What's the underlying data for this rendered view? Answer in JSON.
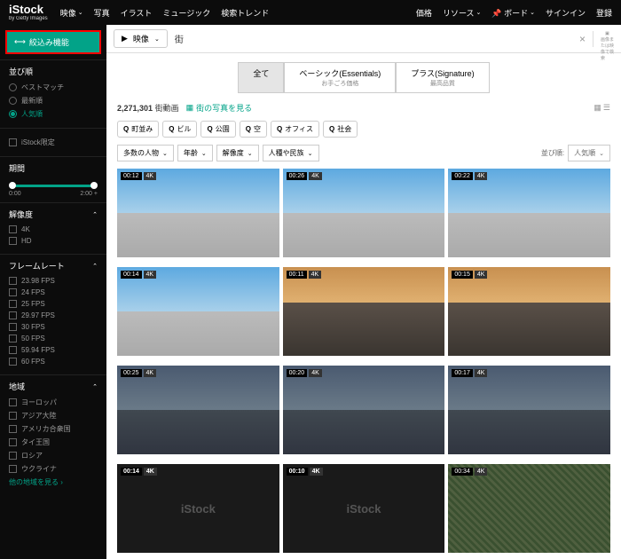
{
  "logo": {
    "main": "iStock",
    "sub": "by Getty Images"
  },
  "topnav": {
    "items": [
      "映像",
      "写真",
      "イラスト",
      "ミュージック",
      "検索トレンド"
    ],
    "right": [
      "価格",
      "リソース",
      "ボード",
      "サインイン",
      "登録"
    ]
  },
  "filter_button": "絞込み機能",
  "sidebar": {
    "sort": {
      "title": "並び順",
      "options": [
        "ベストマッチ",
        "最新順",
        "人気順"
      ],
      "selected": 2
    },
    "exclusive": "iStock限定",
    "duration": {
      "title": "期間",
      "min": "0:00",
      "max": "2:00 +"
    },
    "resolution": {
      "title": "解像度",
      "options": [
        "4K",
        "HD"
      ]
    },
    "framerate": {
      "title": "フレームレート",
      "options": [
        "23.98 FPS",
        "24 FPS",
        "25 FPS",
        "29.97 FPS",
        "30 FPS",
        "50 FPS",
        "59.94 FPS",
        "60 FPS"
      ]
    },
    "region": {
      "title": "地域",
      "options": [
        "ヨーロッパ",
        "アジア大陸",
        "アメリカ合衆国",
        "タイ王国",
        "ロシア",
        "ウクライナ"
      ],
      "more": "他の地域を見る"
    }
  },
  "search": {
    "media_type": "映像",
    "term": "街",
    "camera_hint": "画像または映像で検索"
  },
  "tabs": [
    {
      "l": "全て",
      "s": ""
    },
    {
      "l": "ベーシック(Essentials)",
      "s": "お手ごろ価格"
    },
    {
      "l": "プラス(Signature)",
      "s": "最高品質"
    }
  ],
  "results": {
    "count": "2,271,301",
    "label": "街動画",
    "photo_link": "街の写真を見る"
  },
  "chips": [
    {
      "l": "町並み"
    },
    {
      "l": "ビル"
    },
    {
      "l": "公園"
    },
    {
      "l": "空"
    },
    {
      "l": "オフィス"
    },
    {
      "l": "社会"
    }
  ],
  "dropdowns": [
    "多数の人物",
    "年齢",
    "解像度",
    "人種や民族"
  ],
  "sort_label": "並び順:",
  "sort_value": "人気順",
  "thumbs": [
    {
      "d": "00:12",
      "k": "4K",
      "c": "sky"
    },
    {
      "d": "00:26",
      "k": "4K",
      "c": "sky"
    },
    {
      "d": "00:22",
      "k": "4K",
      "c": "sky"
    },
    {
      "d": "00:14",
      "k": "4K",
      "c": "sky"
    },
    {
      "d": "00:11",
      "k": "4K",
      "c": "sunset"
    },
    {
      "d": "00:15",
      "k": "4K",
      "c": "sunset"
    },
    {
      "d": "00:25",
      "k": "4K",
      "c": "dusk"
    },
    {
      "d": "00:20",
      "k": "4K",
      "c": "dusk"
    },
    {
      "d": "00:17",
      "k": "4K",
      "c": "dusk"
    },
    {
      "d": "00:14",
      "k": "4K",
      "c": "night",
      "wm": "iStock"
    },
    {
      "d": "00:10",
      "k": "4K",
      "c": "night",
      "wm": "iStock"
    },
    {
      "d": "00:34",
      "k": "4K",
      "c": "sat"
    }
  ]
}
